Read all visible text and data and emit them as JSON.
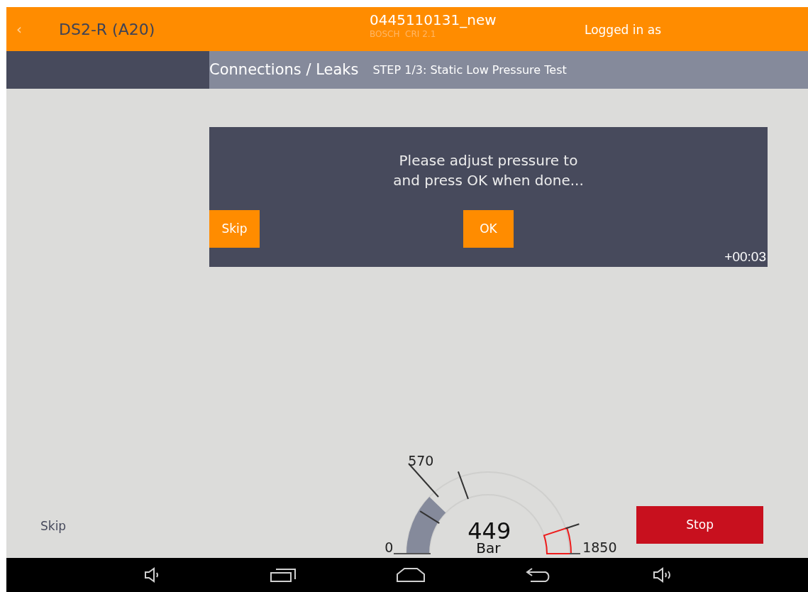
{
  "header": {
    "back": "‹",
    "title": "DS2-R (A20)",
    "part_number": "0445110131_new",
    "subtitle": "BOSCH  CRI 2.1",
    "user": "Logged in as"
  },
  "subheader": {
    "section": "Connections / Leaks",
    "step": "STEP 1/3: Static Low Pressure Test"
  },
  "dialog": {
    "message_lines": [
      "Please adjust pressure to",
      "and press OK when done..."
    ],
    "skip_button": "Skip",
    "ok_button": "OK",
    "timer": "+00:03"
  },
  "skip_link": "Skip",
  "gauge": {
    "value": "449",
    "unit": "Bar",
    "min_label": "0",
    "max_label": "1850",
    "marker_label": "570"
  },
  "stop_button": "Stop"
}
